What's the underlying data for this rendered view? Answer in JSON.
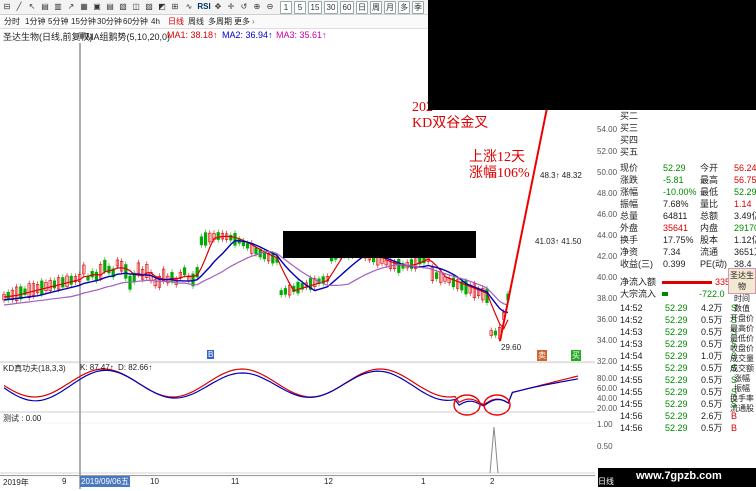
{
  "toolbar": {
    "buttons": [
      "1",
      "5",
      "15",
      "30",
      "60",
      "日",
      "周",
      "月",
      "多",
      "季"
    ],
    "rsi_label": "RSI"
  },
  "periods": [
    "分时",
    "1分钟",
    "5分钟",
    "15分钟",
    "30分钟",
    "60分钟",
    "4h",
    "日线",
    "周线",
    "多周期",
    "更多"
  ],
  "title": {
    "stock": "圣达生物(日线,前复权)",
    "indicator": "MA组鹅势(5,10,20,0)",
    "ma1": "MA1: 38.18↑",
    "ma2": "MA2: 36.94↑",
    "ma3": "MA3: 35.61↑"
  },
  "annotation": {
    "line1": "202",
    "line2": "KD双谷金叉",
    "line3": "上涨12天",
    "line4": "涨幅106%"
  },
  "price_marks": {
    "low": "29.60",
    "mid": "48.3↑ 48.32",
    "mid2": "41.03↑ 41.50"
  },
  "price_axis": [
    "54.00",
    "52.00",
    "50.00",
    "48.00",
    "46.00",
    "44.00",
    "42.00",
    "40.00",
    "38.00",
    "36.00",
    "34.00",
    "32.00",
    "30.00"
  ],
  "kd": {
    "label": "KD真功夫(18,3,3)",
    "k": "K: 87.47↑",
    "d": "D: 82.66↑",
    "axis": [
      "80.00",
      "60.00",
      "40.00",
      "20.00"
    ]
  },
  "test": {
    "label": "测试 : 0.00",
    "axis": [
      "1.00",
      "0.50"
    ]
  },
  "xaxis": [
    "2019年",
    "9",
    "2019/09/06五",
    "10",
    "11",
    "12",
    "1",
    "2"
  ],
  "markers": {
    "b1": "B",
    "s1": "卖",
    "s2": "买"
  },
  "quote": {
    "buy_labels": [
      "买二",
      "买三",
      "买四",
      "买五"
    ],
    "rows": [
      {
        "l": "现价",
        "v": "52.29",
        "l2": "今开",
        "v2": "56.24"
      },
      {
        "l": "涨跌",
        "v": "-5.81",
        "l2": "最高",
        "v2": "56.75"
      },
      {
        "l": "涨幅",
        "v": "-10.00%",
        "l2": "最低",
        "v2": "52.29"
      },
      {
        "l": "振幅",
        "v": "7.68%",
        "l2": "量比",
        "v2": "1.14"
      },
      {
        "l": "总量",
        "v": "64811",
        "l2": "总额",
        "v2": "3.49亿"
      },
      {
        "l": "外盘",
        "v": "35641",
        "l2": "内盘",
        "v2": "29170"
      },
      {
        "l": "换手",
        "v": "17.75%",
        "l2": "股本",
        "v2": "1.12亿"
      },
      {
        "l": "净资",
        "v": "7.34",
        "l2": "流通",
        "v2": "3651万"
      },
      {
        "l": "收益(三)",
        "v": "0.399",
        "l2": "PE(动)",
        "v2": "38.4"
      }
    ],
    "net_in_label": "净流入额",
    "net_in_value": "3352",
    "block_label": "大宗流入",
    "block_value": "-722.0"
  },
  "ticks": [
    {
      "t": "14:52",
      "p": "52.29",
      "v": "4.2万",
      "s": "S"
    },
    {
      "t": "14:52",
      "p": "52.29",
      "v": "0.5万",
      "s": "S"
    },
    {
      "t": "14:53",
      "p": "52.29",
      "v": "0.5万",
      "s": "S"
    },
    {
      "t": "14:53",
      "p": "52.29",
      "v": "0.5万",
      "s": "S"
    },
    {
      "t": "14:54",
      "p": "52.29",
      "v": "1.0万",
      "s": "S"
    },
    {
      "t": "14:55",
      "p": "52.29",
      "v": "0.5万",
      "s": "S"
    },
    {
      "t": "14:55",
      "p": "52.29",
      "v": "0.5万",
      "s": "S"
    },
    {
      "t": "14:55",
      "p": "52.29",
      "v": "0.5万",
      "s": "S"
    },
    {
      "t": "14:55",
      "p": "52.29",
      "v": "0.5万",
      "s": "S"
    },
    {
      "t": "14:56",
      "p": "52.29",
      "v": "2.6万",
      "s": "B"
    },
    {
      "t": "14:56",
      "p": "52.29",
      "v": "0.5万",
      "s": "B"
    }
  ],
  "side_tabs": {
    "stock": "圣达生物",
    "items": [
      "时间",
      "数值",
      "开盘价",
      "最高价",
      "最低价",
      "收盘价",
      "成交量",
      "成交额",
      "涨幅",
      "振幅",
      "换手率",
      "流通股"
    ]
  },
  "bottom": {
    "rili": "日线"
  },
  "watermark": "www.7gpzb.com"
}
